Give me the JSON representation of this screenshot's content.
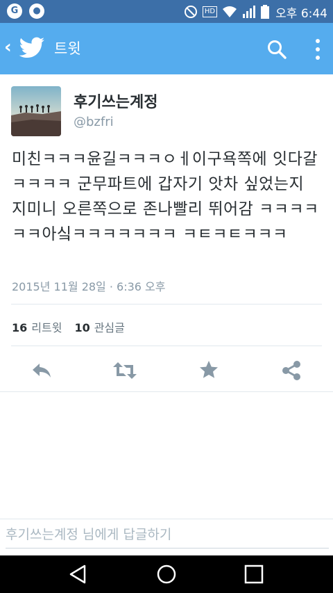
{
  "status_bar": {
    "time": "오후 6:44",
    "hd_label": "HD"
  },
  "app_bar": {
    "title": "트윗"
  },
  "tweet": {
    "author_name": "후기쓰는계정",
    "author_handle": "@bzfri",
    "text": "미친ㅋㅋㅋ윤길ㅋㅋㅋㅇㅔ이구욕쪽에 잇다갈ㅋㅋㅋㅋ 군무파트에 갑자기 앗차 싶었는지 지미니 오른쪽으로 존나빨리 뛰어감 ㅋㅋㅋㅋㅋㅋ아싴ㅋㅋㅋㅋㅋㅋㅋ ㅋㅌㅋㅌㅋㅋㅋ",
    "timestamp": "2015년 11월 28일 · 6:36 오후",
    "retweet_count": "16",
    "retweet_label": "리트윗",
    "favorite_count": "10",
    "favorite_label": "관심글"
  },
  "reply": {
    "placeholder": "후기쓰는계정 님에게 답글하기"
  },
  "colors": {
    "status_bar": "#3c6fa8",
    "app_bar": "#55acee",
    "action_icons": "#8899a6"
  },
  "icons": [
    "back-icon",
    "twitter-bird-icon",
    "search-icon",
    "more-vert-icon",
    "reply-icon",
    "retweet-icon",
    "favorite-star-icon",
    "share-icon",
    "nav-back-icon",
    "nav-home-icon",
    "nav-recents-icon"
  ]
}
